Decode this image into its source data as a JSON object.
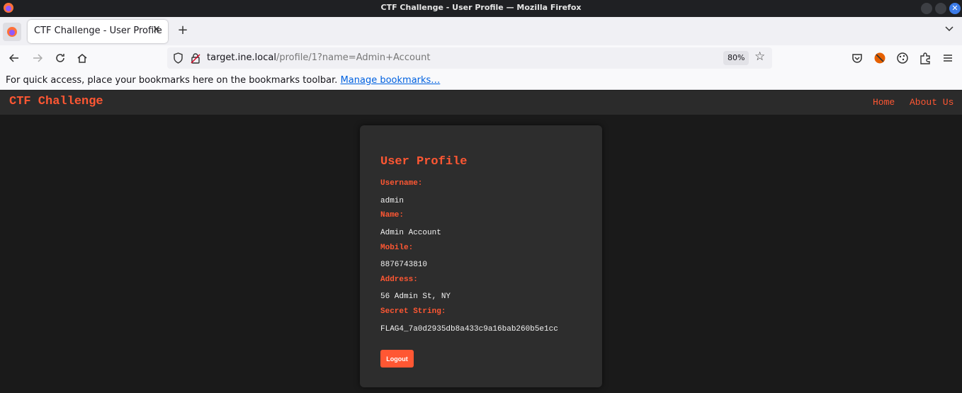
{
  "window": {
    "title": "CTF Challenge - User Profile — Mozilla Firefox"
  },
  "tab": {
    "label": "CTF Challenge - User Profile",
    "close_glyph": "✕"
  },
  "toolbar": {
    "new_tab_glyph": "+",
    "url_host": "target.ine.local",
    "url_path": "/profile/1?name=Admin+Account",
    "zoom": "80%",
    "star_glyph": "☆"
  },
  "bookmarks_bar": {
    "message": "For quick access, place your bookmarks here on the bookmarks toolbar.",
    "link": "Manage bookmarks…"
  },
  "site": {
    "brand": "CTF Challenge",
    "nav": {
      "home": "Home",
      "about": "About Us"
    }
  },
  "profile": {
    "heading": "User Profile",
    "fields": [
      {
        "label": "Username:",
        "value": "admin"
      },
      {
        "label": "Name:",
        "value": "Admin Account"
      },
      {
        "label": "Mobile:",
        "value": "8876743810"
      },
      {
        "label": "Address:",
        "value": "56 Admin St, NY"
      },
      {
        "label": "Secret String:",
        "value": "FLAG4_7a0d2935db8a433c9a16bab260b5e1cc"
      }
    ],
    "logout_label": "Logout"
  },
  "colors": {
    "accent": "#ff5733",
    "page_bg": "#1a1a1a",
    "card_bg": "#2d2d2d",
    "header_bg": "#2b2b2b"
  }
}
